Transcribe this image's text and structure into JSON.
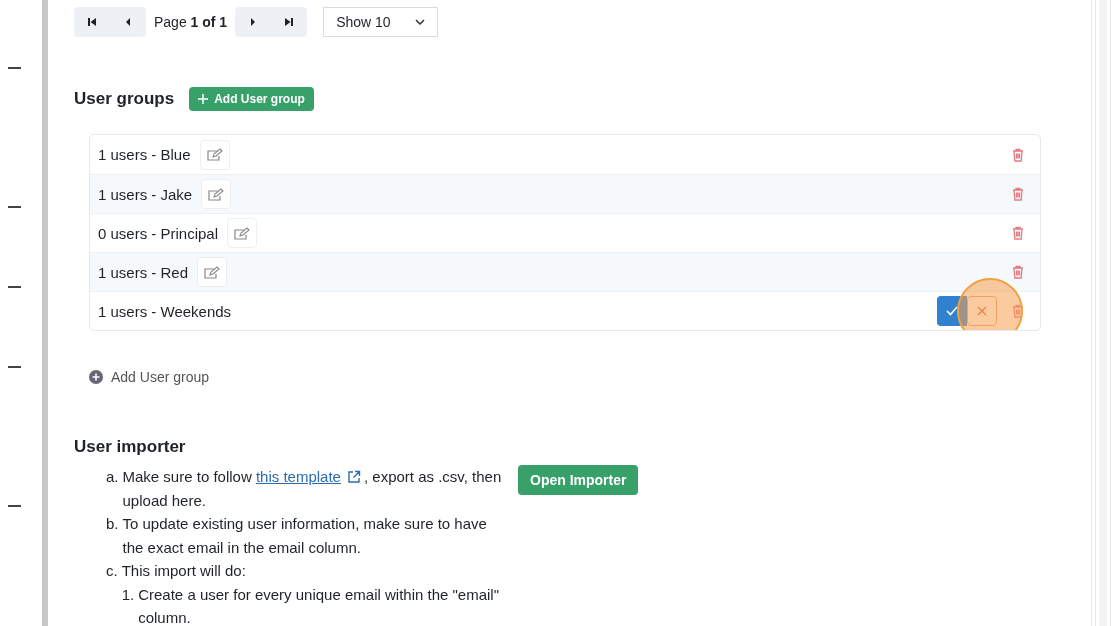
{
  "pagination": {
    "page_label": "Page",
    "page_value": "1 of 1",
    "page_size": "Show 10"
  },
  "user_groups": {
    "title": "User groups",
    "add_button": "Add User group",
    "groups": [
      {
        "label": "1 users - Blue",
        "editing": false
      },
      {
        "label": "1 users - Jake",
        "editing": false
      },
      {
        "label": "0 users - Principal",
        "editing": false
      },
      {
        "label": "1 users - Red",
        "editing": false
      },
      {
        "label": "1 users - Weekends",
        "editing": true
      }
    ],
    "add_link": "Add User group"
  },
  "user_importer": {
    "title": "User importer",
    "button": "Open Importer",
    "steps": [
      {
        "marker": "a.",
        "text_before": "Make sure to follow ",
        "link": "this template",
        "text_after": ", export as .csv, then upload here."
      },
      {
        "marker": "b.",
        "text": "To update existing user information, make sure to have the exact email in the email column."
      },
      {
        "marker": "c.",
        "text": "This import will do:",
        "children": [
          {
            "marker": "1.",
            "text": "Create a user for every unique email within the \"email\" column."
          }
        ]
      }
    ]
  }
}
